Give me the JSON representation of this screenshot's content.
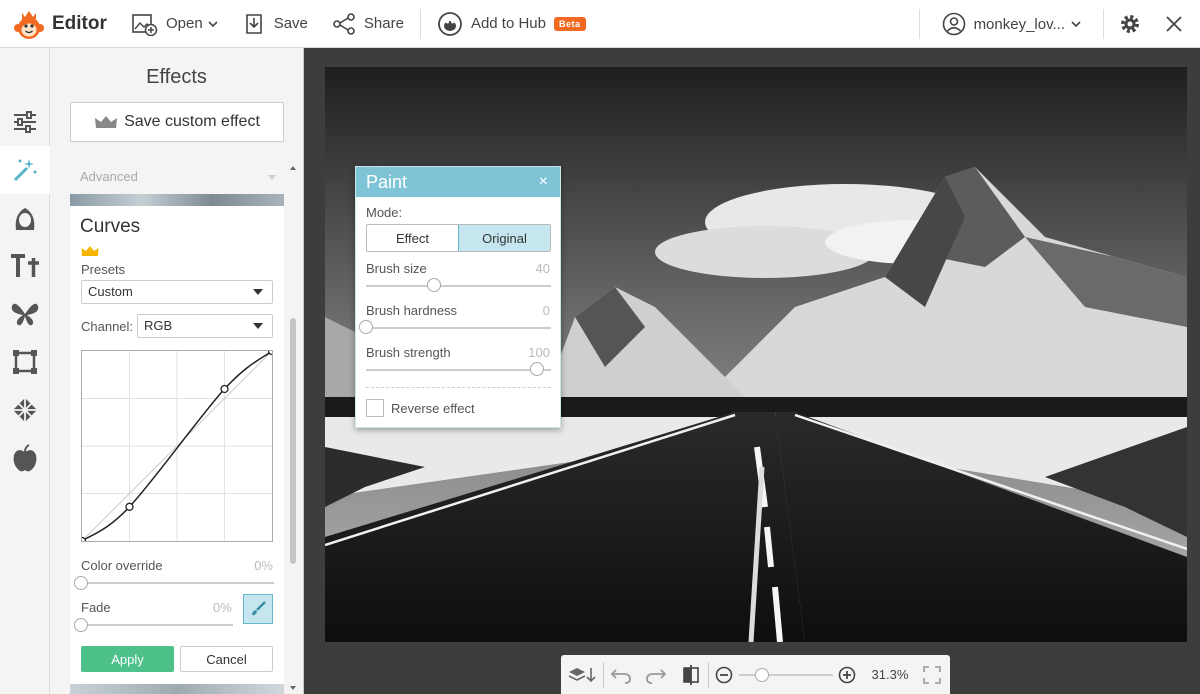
{
  "app": {
    "title": "Editor",
    "toolbar": {
      "open_label": "Open",
      "save_label": "Save",
      "share_label": "Share",
      "hub_label": "Add to Hub",
      "beta_badge": "Beta",
      "user_name": "monkey_lov..."
    },
    "colors": {
      "accent_teal": "#7ec4d6",
      "apply_green": "#4ec08a",
      "beta_orange": "#f26a21",
      "crown_gold": "#f5b400"
    }
  },
  "rail": {
    "items": [
      "adjust-icon",
      "magic-wand-icon",
      "touch-up-icon",
      "text-icon",
      "butterfly-icon",
      "frame-icon",
      "texture-icon",
      "apple-icon"
    ],
    "active": "magic-wand-icon"
  },
  "effects_panel": {
    "title": "Effects",
    "save_custom_label": "Save custom effect",
    "category_label": "Advanced",
    "curves": {
      "title": "Curves",
      "presets_label": "Presets",
      "presets_value": "Custom",
      "channel_label": "Channel:",
      "channel_value": "RGB",
      "curve_points": [
        [
          0,
          0
        ],
        [
          25,
          18
        ],
        [
          75,
          80
        ],
        [
          100,
          100
        ]
      ],
      "color_override_label": "Color override",
      "color_override_value": "0%",
      "color_override_level": 0,
      "fade_label": "Fade",
      "fade_value": "0%",
      "fade_level": 0,
      "apply_label": "Apply",
      "cancel_label": "Cancel"
    }
  },
  "paint_panel": {
    "title": "Paint",
    "close_glyph": "×",
    "mode_label": "Mode:",
    "mode_options": [
      "Effect",
      "Original"
    ],
    "mode_selected": "Original",
    "brush_size_label": "Brush size",
    "brush_size_value": "40",
    "brush_size_level": 0.4,
    "brush_hardness_label": "Brush hardness",
    "brush_hardness_value": "0",
    "brush_hardness_level": 0,
    "brush_strength_label": "Brush strength",
    "brush_strength_value": "100",
    "brush_strength_level": 1,
    "reverse_label": "Reverse effect",
    "reverse_checked": false
  },
  "bottom_toolbar": {
    "zoom_text": "31.3%",
    "zoom_level": 0.25
  }
}
